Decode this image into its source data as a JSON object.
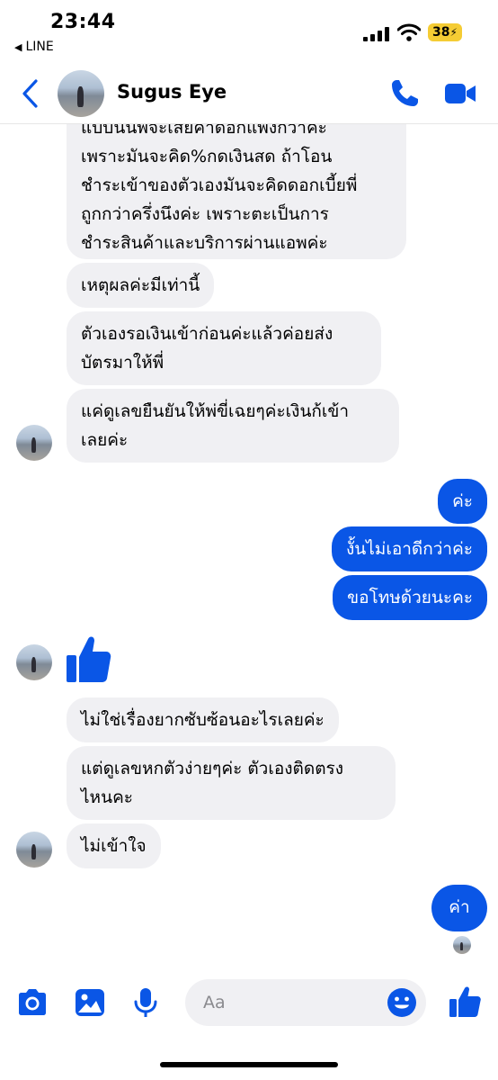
{
  "status_bar": {
    "time": "23:44",
    "back_app": "LINE",
    "battery": "38"
  },
  "header": {
    "name": "Sugus Eye"
  },
  "messages": {
    "m1_lines": [
      "แบบนั้นพี่จะเสียค่าดอกแพงกว่าค่ะ",
      "เพราะมันจะคิด%กดเงินสด ถ้าโอน",
      "ชำระเข้าของตัวเองมันจะคิดดอกเบี้ยพี่",
      "ถูกกว่าครึ่งนึงค่ะ เพราะตะเป็นการ",
      "ชำระสินค้าและบริการผ่านแอพค่ะ"
    ],
    "m2": "เหตุผลค่ะมีเท่านี้",
    "m3_line1": "ตัวเองรอเงินเข้าก่อนค่ะแล้วค่อยส่ง",
    "m3_line2": "บัตรมาให้พี่",
    "m4_line1": "แค่ดูเลขยืนยันให้พ่ขี่เฉยๆค่ะเงินก้เข้า",
    "m4_line2": "เลยค่ะ",
    "o1": "ค่ะ",
    "o2": "งั้นไม่เอาดีกว่าค่ะ",
    "o3": "ขอโทษด้วยนะคะ",
    "m5": "ไม่ใช่เรื่องยากซับซ้อนอะไรเลยค่ะ",
    "m6_line1": "แต่ดูเลขหกตัวง่ายๆค่ะ ตัวเองติดตรง",
    "m6_line2": "ไหนคะ",
    "m7": "ไม่เข้าใจ",
    "o4": "ค่า"
  },
  "composer": {
    "placeholder": "Aa"
  },
  "colors": {
    "accent": "#0a56e6",
    "incoming_bubble": "#f0f0f3",
    "battery": "#f5cc34"
  },
  "icons": [
    "back-chevron-icon",
    "phone-icon",
    "video-camera-icon",
    "thumbs-up-icon",
    "camera-icon",
    "photo-icon",
    "microphone-icon",
    "emoji-icon",
    "signal-icon",
    "wifi-icon"
  ]
}
